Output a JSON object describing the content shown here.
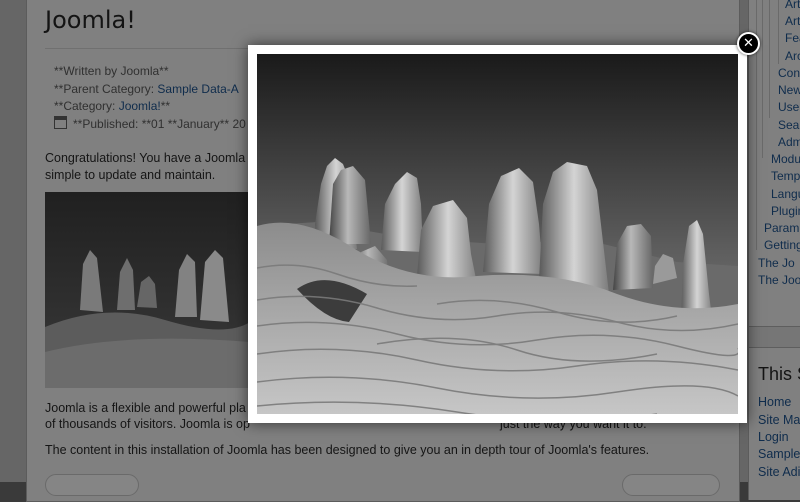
{
  "article": {
    "title": "Joomla!",
    "meta": {
      "written_by": "**Written by Joomla**",
      "parent_label": "**Parent Category: ",
      "parent_link": "Sample Data-A",
      "category_label": "**Category: ",
      "category_link": "Joomla!",
      "category_suffix": "**",
      "published": "**Published: **01 **January** 20"
    },
    "paragraphs": [
      "Congratulations! You have a Joomla",
      "simple to update and maintain.",
      "Joomla is a flexible and powerful pla",
      "of thousands of visitors. Joomla is op",
      "The content in this installation of Joomla has been designed to give you an in depth tour of Joomla's features."
    ],
    "paragraph_tail": "just the way you want it to."
  },
  "sidebar": {
    "menu_items": [
      "Art",
      "Art",
      "Fea",
      "Arc",
      "Con",
      "New",
      "Use",
      "Sea",
      "Adm",
      "Modu",
      "Temp",
      "Langu",
      "Plugin",
      "Param",
      "Getting",
      "The Jo",
      "The Joo"
    ],
    "module_title": "This S",
    "module_links": [
      "Home",
      "Site Ma",
      "Login",
      "Sample",
      "Site Adi"
    ]
  },
  "lightbox": {
    "close_symbol": "✕",
    "image_subject": "pinnacles desert black and white photo"
  },
  "colors": {
    "overlay_tint": "#808080",
    "link": "#0f2c4c",
    "frame": "#ffffff",
    "close_button": "#000000"
  }
}
